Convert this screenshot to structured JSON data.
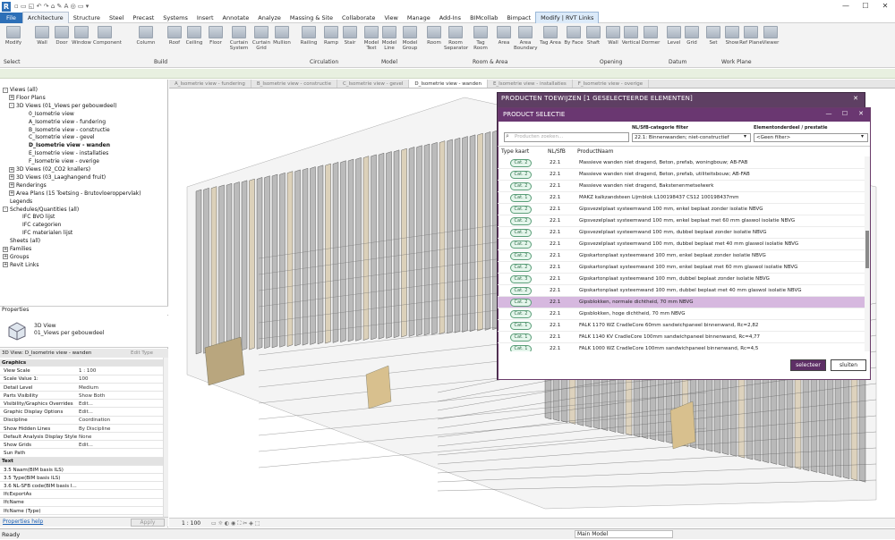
{
  "app": {
    "logo_letter": "R",
    "window_controls": [
      "—",
      "☐",
      "✕"
    ]
  },
  "menu": [
    "File",
    "Architecture",
    "Structure",
    "Steel",
    "Precast",
    "Systems",
    "Insert",
    "Annotate",
    "Analyze",
    "Massing & Site",
    "Collaborate",
    "View",
    "Manage",
    "Add-Ins",
    "BIMcollab",
    "Bimpact",
    "Modify | RVT Links"
  ],
  "ribbon": {
    "buttons": [
      "Modify",
      "Wall",
      "Door",
      "Window",
      "Component",
      "Column",
      "Roof",
      "Ceiling",
      "Floor",
      "Curtain System",
      "Curtain Grid",
      "Mullion",
      "Railing",
      "Ramp",
      "Stair",
      "Model Text",
      "Model Line",
      "Model Group",
      "Room",
      "Room Separator",
      "Tag Room",
      "Area",
      "Area Boundary",
      "Tag Area",
      "By Face",
      "Shaft",
      "Wall",
      "Vertical",
      "Dormer",
      "Level",
      "Grid",
      "Set",
      "Show",
      "Ref Plane",
      "Viewer"
    ],
    "groups": [
      "Select",
      "Build",
      "Circulation",
      "Model",
      "Room & Area",
      "Opening",
      "Datum",
      "Work Plane"
    ]
  },
  "browser": {
    "items": [
      {
        "label": "Views (all)",
        "indent": 0,
        "exp": "-"
      },
      {
        "label": "Floor Plans",
        "indent": 1,
        "exp": "+"
      },
      {
        "label": "3D Views (01_Views per gebouwdeel)",
        "indent": 1,
        "exp": "-"
      },
      {
        "label": "0_Isometrie view",
        "indent": 3,
        "exp": ""
      },
      {
        "label": "A_Isometrie view - fundering",
        "indent": 3,
        "exp": ""
      },
      {
        "label": "B_Isometrie view - constructie",
        "indent": 3,
        "exp": ""
      },
      {
        "label": "C_Isometrie view - gevel",
        "indent": 3,
        "exp": ""
      },
      {
        "label": "D_Isometrie view - wanden",
        "indent": 3,
        "exp": "",
        "bold": true
      },
      {
        "label": "E_Isometrie view - installaties",
        "indent": 3,
        "exp": ""
      },
      {
        "label": "F_Isometrie view - overige",
        "indent": 3,
        "exp": ""
      },
      {
        "label": "3D Views (02_CO2 knallers)",
        "indent": 1,
        "exp": "+"
      },
      {
        "label": "3D Views (03_Laaghangend fruit)",
        "indent": 1,
        "exp": "+"
      },
      {
        "label": "Renderings",
        "indent": 1,
        "exp": "+"
      },
      {
        "label": "Area Plans (15 Toetsing - Brutovloeroppervlak)",
        "indent": 1,
        "exp": "+"
      },
      {
        "label": "Legends",
        "indent": 0,
        "exp": ""
      },
      {
        "label": "Schedules/Quantities (all)",
        "indent": 0,
        "exp": "-"
      },
      {
        "label": "IFC BVO lijst",
        "indent": 2,
        "exp": ""
      },
      {
        "label": "IFC categorien",
        "indent": 2,
        "exp": ""
      },
      {
        "label": "IFC materialen lijst",
        "indent": 2,
        "exp": ""
      },
      {
        "label": "Sheets (all)",
        "indent": 0,
        "exp": ""
      },
      {
        "label": "Families",
        "indent": 0,
        "exp": "+"
      },
      {
        "label": "Groups",
        "indent": 0,
        "exp": "+"
      },
      {
        "label": "Revit Links",
        "indent": 0,
        "exp": "+"
      }
    ]
  },
  "properties": {
    "title": "Properties",
    "type_name": "3D View",
    "type_sub": "01_Views per gebouwdeel",
    "instance": "3D View: D_Isometrie view - wanden",
    "edit_type": "Edit Type",
    "rows": [
      {
        "k": "Graphics",
        "v": "",
        "hdr": true
      },
      {
        "k": "View Scale",
        "v": "1 : 100"
      },
      {
        "k": "Scale Value   1:",
        "v": "100"
      },
      {
        "k": "Detail Level",
        "v": "Medium"
      },
      {
        "k": "Parts Visibility",
        "v": "Show Both"
      },
      {
        "k": "Visibility/Graphics Overrides",
        "v": "Edit..."
      },
      {
        "k": "Graphic Display Options",
        "v": "Edit..."
      },
      {
        "k": "Discipline",
        "v": "Coordination"
      },
      {
        "k": "Show Hidden Lines",
        "v": "By Discipline"
      },
      {
        "k": "Default Analysis Display Style",
        "v": "None"
      },
      {
        "k": "Show Grids",
        "v": "Edit..."
      },
      {
        "k": "Sun Path",
        "v": ""
      },
      {
        "k": "Text",
        "v": "",
        "hdr": true
      },
      {
        "k": "3.5 Naam(BIM basis ILS)",
        "v": ""
      },
      {
        "k": "3.5 Type(BIM basis ILS)",
        "v": ""
      },
      {
        "k": "3.6 NL-SFB code(BIM basis I...",
        "v": ""
      },
      {
        "k": "IfcExportAs",
        "v": ""
      },
      {
        "k": "IfcName",
        "v": ""
      },
      {
        "k": "IfcName (Type)",
        "v": ""
      }
    ],
    "help": "Properties help",
    "apply": "Apply"
  },
  "view_tabs": [
    "A_Isometrie view - fundering",
    "B_Isometrie view - constructie",
    "C_Isometrie view - gevel",
    "D_Isometrie view - wanden",
    "E_Isometrie view - installaties",
    "F_Isometrie view - overige"
  ],
  "view_scale": "1 : 100",
  "status": {
    "left": "Ready",
    "model": "Main Model"
  },
  "dialog_outer": {
    "title": "PRODUCTEN TOEWIJZEN [1 GESELECTEERDE ELEMENTEN]"
  },
  "dialog": {
    "title": "PRODUCT SELECTIE",
    "search_placeholder": "Producten zoeken...",
    "filter1_label": "NL/SfB-categorie filter",
    "filter1_value": "22.1: Binnenwanden; niet-constructief",
    "filter2_label": "Elementonderdeel / prestatie",
    "filter2_value": "<Geen filter>",
    "columns": [
      "Type kaart",
      "NL/SfB",
      "ProductNaam"
    ],
    "rows": [
      {
        "cat": "Cat. 2",
        "sfb": "22.1",
        "name": "Massieve wanden niet dragend, Beton, prefab, woningbouw; AB-FAB"
      },
      {
        "cat": "Cat. 2",
        "sfb": "22.1",
        "name": "Massieve wanden niet dragend, Beton, prefab, utiliteitsbouw; AB-FAB"
      },
      {
        "cat": "Cat. 2",
        "sfb": "22.1",
        "name": "Massieve wanden niet dragend, Bakstenenmetselwerk"
      },
      {
        "cat": "Cat. 1",
        "sfb": "22.1",
        "name": "MAKZ kalkzandsteen Lijmblok L100198437 CS12 100198437mm"
      },
      {
        "cat": "Cat. 2",
        "sfb": "22.1",
        "name": "Gipsvezelplaat systeemwand 100 mm, enkel beplaat zonder isolatie NBVG"
      },
      {
        "cat": "Cat. 2",
        "sfb": "22.1",
        "name": "Gipsvezelplaat systeemwand 100 mm, enkel beplaat met 60 mm glaswol isolatie NBVG"
      },
      {
        "cat": "Cat. 2",
        "sfb": "22.1",
        "name": "Gipsvezelplaat systeemwand 100 mm, dubbel beplaat zonder isolatie NBVG"
      },
      {
        "cat": "Cat. 2",
        "sfb": "22.1",
        "name": "Gipsvezelplaat systeemwand 100 mm, dubbel beplaat met 40 mm glaswol isolatie NBVG"
      },
      {
        "cat": "Cat. 2",
        "sfb": "22.1",
        "name": "Gipskartonplaat systeemwand 100 mm, enkel beplaat zonder isolatie NBVG"
      },
      {
        "cat": "Cat. 2",
        "sfb": "22.1",
        "name": "Gipskartonplaat systeemwand 100 mm, enkel beplaat met 60 mm glaswol isolatie NBVG"
      },
      {
        "cat": "Cat. 3",
        "sfb": "22.1",
        "name": "Gipskartonplaat systeemwand 100 mm, dubbel beplaat zonder isolatie NBVG"
      },
      {
        "cat": "Cat. 2",
        "sfb": "22.1",
        "name": "Gipskartonplaat systeemwand 100 mm, dubbel beplaat met 40 mm glaswol isolatie NBVG"
      },
      {
        "cat": "Cat. 2",
        "sfb": "22.1",
        "name": "Gipsblokken, normale dichtheid, 70 mm NBVG",
        "selected": true
      },
      {
        "cat": "Cat. 2",
        "sfb": "22.1",
        "name": "Gipsblokken, hoge dichtheid, 70 mm NBVG"
      },
      {
        "cat": "Cat. 1",
        "sfb": "22.1",
        "name": "FALK 1170 WZ CradleCore 60mm sandwichpaneel binnenwand, Rc=2,82"
      },
      {
        "cat": "Cat. 1",
        "sfb": "22.1",
        "name": "FALK 1140 KV CradleCore 100mm sandwichpaneel binnenwand, Rc=4,77"
      },
      {
        "cat": "Cat. 1",
        "sfb": "22.1",
        "name": "FALK 1000 WZ CradleCore 100mm sandwichpaneel binnenwand, Rc=4,5"
      }
    ],
    "btn_select": "selecteer",
    "btn_close": "sluiten"
  },
  "colors": {
    "accent": "#6a3771",
    "selected_row": "#d6b8df",
    "cat_badge": "#5a9e78",
    "revit_blue": "#2d6fb7"
  }
}
